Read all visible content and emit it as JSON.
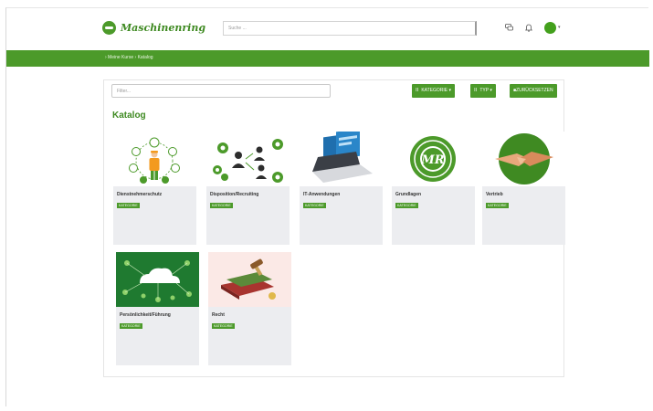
{
  "header": {
    "logo_text": "Maschinenring",
    "search_placeholder": "Suche ...",
    "icons": [
      "chat-icon",
      "bell-icon",
      "avatar"
    ],
    "colors": {
      "brand": "#4c9a2a",
      "avatar": "#43a01c"
    }
  },
  "nav": {
    "breadcrumb": "› Meine Kurse › Katalog"
  },
  "toolbar": {
    "filter_placeholder": "Filter...",
    "category_label": "KATEGORIE",
    "type_label": "TYP",
    "reset_label": "ZURÜCKSETZEN"
  },
  "catalog": {
    "heading": "Katalog",
    "cards": [
      {
        "title": "Dienstnehmerschutz",
        "badge": "KATEGORIE",
        "image": "worker-safety-illustration"
      },
      {
        "title": "Disposition/Recruiting",
        "badge": "KATEGORIE",
        "image": "people-gears-illustration"
      },
      {
        "title": "IT-Anwendungen",
        "badge": "KATEGORIE",
        "image": "laptop-screens-illustration"
      },
      {
        "title": "Grundlagen",
        "badge": "KATEGORIE",
        "image": "mr-logo-emblem"
      },
      {
        "title": "Vertrieb",
        "badge": "KATEGORIE",
        "image": "handshake-illustration"
      },
      {
        "title": "Persönlichkeit/Führung",
        "badge": "KATEGORIE",
        "image": "cloud-mindmap-illustration"
      },
      {
        "title": "Recht",
        "badge": "KATEGORIE",
        "image": "law-books-gavel-illustration"
      }
    ]
  }
}
